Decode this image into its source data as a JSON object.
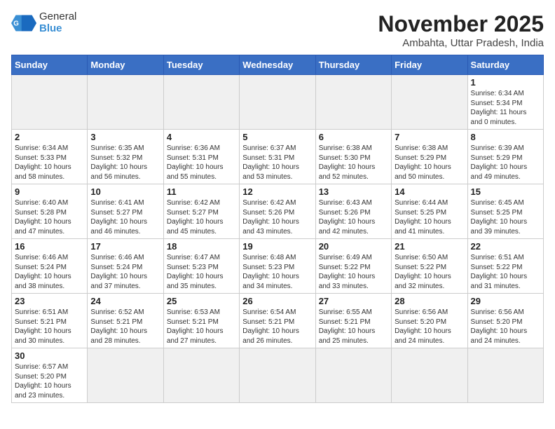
{
  "header": {
    "logo_general": "General",
    "logo_blue": "Blue",
    "month_year": "November 2025",
    "location": "Ambahta, Uttar Pradesh, India"
  },
  "weekdays": [
    "Sunday",
    "Monday",
    "Tuesday",
    "Wednesday",
    "Thursday",
    "Friday",
    "Saturday"
  ],
  "weeks": [
    [
      {
        "day": "",
        "info": "",
        "empty": true
      },
      {
        "day": "",
        "info": "",
        "empty": true
      },
      {
        "day": "",
        "info": "",
        "empty": true
      },
      {
        "day": "",
        "info": "",
        "empty": true
      },
      {
        "day": "",
        "info": "",
        "empty": true
      },
      {
        "day": "",
        "info": "",
        "empty": true
      },
      {
        "day": "1",
        "info": "Sunrise: 6:34 AM\nSunset: 5:34 PM\nDaylight: 11 hours\nand 0 minutes."
      }
    ],
    [
      {
        "day": "2",
        "info": "Sunrise: 6:34 AM\nSunset: 5:33 PM\nDaylight: 10 hours\nand 58 minutes."
      },
      {
        "day": "3",
        "info": "Sunrise: 6:35 AM\nSunset: 5:32 PM\nDaylight: 10 hours\nand 56 minutes."
      },
      {
        "day": "4",
        "info": "Sunrise: 6:36 AM\nSunset: 5:31 PM\nDaylight: 10 hours\nand 55 minutes."
      },
      {
        "day": "5",
        "info": "Sunrise: 6:37 AM\nSunset: 5:31 PM\nDaylight: 10 hours\nand 53 minutes."
      },
      {
        "day": "6",
        "info": "Sunrise: 6:38 AM\nSunset: 5:30 PM\nDaylight: 10 hours\nand 52 minutes."
      },
      {
        "day": "7",
        "info": "Sunrise: 6:38 AM\nSunset: 5:29 PM\nDaylight: 10 hours\nand 50 minutes."
      },
      {
        "day": "8",
        "info": "Sunrise: 6:39 AM\nSunset: 5:29 PM\nDaylight: 10 hours\nand 49 minutes."
      }
    ],
    [
      {
        "day": "9",
        "info": "Sunrise: 6:40 AM\nSunset: 5:28 PM\nDaylight: 10 hours\nand 47 minutes."
      },
      {
        "day": "10",
        "info": "Sunrise: 6:41 AM\nSunset: 5:27 PM\nDaylight: 10 hours\nand 46 minutes."
      },
      {
        "day": "11",
        "info": "Sunrise: 6:42 AM\nSunset: 5:27 PM\nDaylight: 10 hours\nand 45 minutes."
      },
      {
        "day": "12",
        "info": "Sunrise: 6:42 AM\nSunset: 5:26 PM\nDaylight: 10 hours\nand 43 minutes."
      },
      {
        "day": "13",
        "info": "Sunrise: 6:43 AM\nSunset: 5:26 PM\nDaylight: 10 hours\nand 42 minutes."
      },
      {
        "day": "14",
        "info": "Sunrise: 6:44 AM\nSunset: 5:25 PM\nDaylight: 10 hours\nand 41 minutes."
      },
      {
        "day": "15",
        "info": "Sunrise: 6:45 AM\nSunset: 5:25 PM\nDaylight: 10 hours\nand 39 minutes."
      }
    ],
    [
      {
        "day": "16",
        "info": "Sunrise: 6:46 AM\nSunset: 5:24 PM\nDaylight: 10 hours\nand 38 minutes."
      },
      {
        "day": "17",
        "info": "Sunrise: 6:46 AM\nSunset: 5:24 PM\nDaylight: 10 hours\nand 37 minutes."
      },
      {
        "day": "18",
        "info": "Sunrise: 6:47 AM\nSunset: 5:23 PM\nDaylight: 10 hours\nand 35 minutes."
      },
      {
        "day": "19",
        "info": "Sunrise: 6:48 AM\nSunset: 5:23 PM\nDaylight: 10 hours\nand 34 minutes."
      },
      {
        "day": "20",
        "info": "Sunrise: 6:49 AM\nSunset: 5:22 PM\nDaylight: 10 hours\nand 33 minutes."
      },
      {
        "day": "21",
        "info": "Sunrise: 6:50 AM\nSunset: 5:22 PM\nDaylight: 10 hours\nand 32 minutes."
      },
      {
        "day": "22",
        "info": "Sunrise: 6:51 AM\nSunset: 5:22 PM\nDaylight: 10 hours\nand 31 minutes."
      }
    ],
    [
      {
        "day": "23",
        "info": "Sunrise: 6:51 AM\nSunset: 5:21 PM\nDaylight: 10 hours\nand 30 minutes."
      },
      {
        "day": "24",
        "info": "Sunrise: 6:52 AM\nSunset: 5:21 PM\nDaylight: 10 hours\nand 28 minutes."
      },
      {
        "day": "25",
        "info": "Sunrise: 6:53 AM\nSunset: 5:21 PM\nDaylight: 10 hours\nand 27 minutes."
      },
      {
        "day": "26",
        "info": "Sunrise: 6:54 AM\nSunset: 5:21 PM\nDaylight: 10 hours\nand 26 minutes."
      },
      {
        "day": "27",
        "info": "Sunrise: 6:55 AM\nSunset: 5:21 PM\nDaylight: 10 hours\nand 25 minutes."
      },
      {
        "day": "28",
        "info": "Sunrise: 6:56 AM\nSunset: 5:20 PM\nDaylight: 10 hours\nand 24 minutes."
      },
      {
        "day": "29",
        "info": "Sunrise: 6:56 AM\nSunset: 5:20 PM\nDaylight: 10 hours\nand 24 minutes."
      }
    ],
    [
      {
        "day": "30",
        "info": "Sunrise: 6:57 AM\nSunset: 5:20 PM\nDaylight: 10 hours\nand 23 minutes.",
        "last": true
      },
      {
        "day": "",
        "info": "",
        "empty": true,
        "last": true
      },
      {
        "day": "",
        "info": "",
        "empty": true,
        "last": true
      },
      {
        "day": "",
        "info": "",
        "empty": true,
        "last": true
      },
      {
        "day": "",
        "info": "",
        "empty": true,
        "last": true
      },
      {
        "day": "",
        "info": "",
        "empty": true,
        "last": true
      },
      {
        "day": "",
        "info": "",
        "empty": true,
        "last": true
      }
    ]
  ]
}
